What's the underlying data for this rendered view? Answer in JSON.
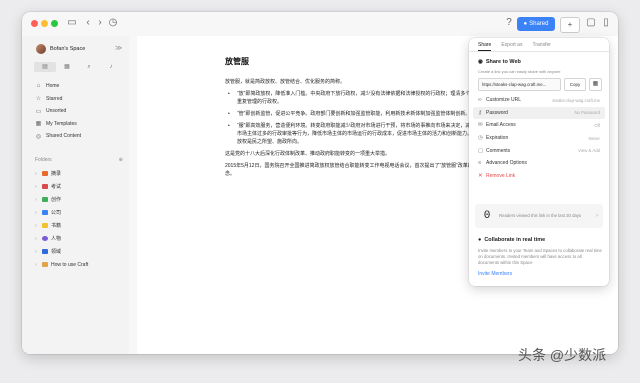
{
  "titlebar": {
    "shared_label": "Shared",
    "plus_label": "+"
  },
  "sidebar": {
    "space_name": "Bofan's Space",
    "nav": [
      {
        "label": "Home",
        "icon": "house-icon"
      },
      {
        "label": "Starred",
        "icon": "star-icon"
      },
      {
        "label": "Unsorted",
        "icon": "tray-icon"
      },
      {
        "label": "My Templates",
        "icon": "template-icon"
      },
      {
        "label": "Shared Content",
        "icon": "share-icon"
      }
    ],
    "folders_label": "Folders",
    "folders": [
      {
        "label": "摘录",
        "color": "#e66a2c"
      },
      {
        "label": "考试",
        "color": "#d94a4a"
      },
      {
        "label": "创作",
        "color": "#3fae5a"
      },
      {
        "label": "公司",
        "color": "#3b82f6"
      },
      {
        "label": "书籍",
        "color": "#f2c230"
      },
      {
        "label": "人物",
        "color": "#7c5cd6"
      },
      {
        "label": "领域",
        "color": "#2f6bd9"
      },
      {
        "label": "How to use Craft",
        "color": "#e0a44a"
      }
    ]
  },
  "doc": {
    "title": "放管服",
    "intro": "放管服，就是简政放权、放管结合、优化服务的简称。",
    "bullets": [
      "“放”即简政放权，降低准入门槛。中央政府下放行政权，减少没有法律依据和法律授权的行政权；理清多个部门重复管理的行政权。",
      "“管”即创新监管，促进公平竞争。政府部门要创新和加强监管职能，利用新技术新体制加强监管体制创新。",
      "“服”即高效服务，营造便利环境。转变政府职能减少政府对市场进行干预，将市场的事推向市场来决定，减少对市场主体过多的行政审批等行为，降低市场主体的市场运行的行政成本，促进市场主体的活力和创新能力。简政放权是民之所望、施政所向。"
    ],
    "para2": "这是党的十八大后深化行政体制改革、推动政府职能转变的一项重大举措。",
    "para3": "2015年5月12日，国务院召开全国推进简政放权放管结合职能转变工作电视电话会议，首次提出了“放管服”改革的概念。"
  },
  "panel": {
    "tabs": [
      "Share",
      "Export as",
      "Transfer"
    ],
    "share_title": "Share to Web",
    "share_sub": "Create a link you can easily share with anyone",
    "link": "https://steaks-clap-wag.craft.me...",
    "copy_label": "Copy",
    "options": [
      {
        "label": "Customize URL",
        "value": "steaks-clap-wag.craft.me",
        "icon": "link-icon"
      },
      {
        "label": "Password",
        "value": "No Password",
        "icon": "key-icon"
      },
      {
        "label": "Email Access",
        "value": "Off",
        "icon": "mail-icon"
      },
      {
        "label": "Expiration",
        "value": "Never",
        "icon": "clock-icon"
      },
      {
        "label": "Comments",
        "value": "View & Add",
        "icon": "comment-icon"
      },
      {
        "label": "Advanced Options",
        "value": "",
        "icon": "sliders-icon"
      },
      {
        "label": "Remove Link",
        "value": "",
        "icon": "trash-icon"
      }
    ],
    "readers_count": "0",
    "readers_text": "Readers viewed this link in the last 30 days",
    "collab_title": "Collaborate in real time",
    "collab_text": "Invite members to your Team and Spaces to collaborate real time on documents. Invited members will have access to all documents within this Space",
    "invite_label": "Invite Members"
  },
  "watermark": "头条 @少数派",
  "colors": {
    "accent": "#3b82f6",
    "danger": "#e5484d"
  }
}
